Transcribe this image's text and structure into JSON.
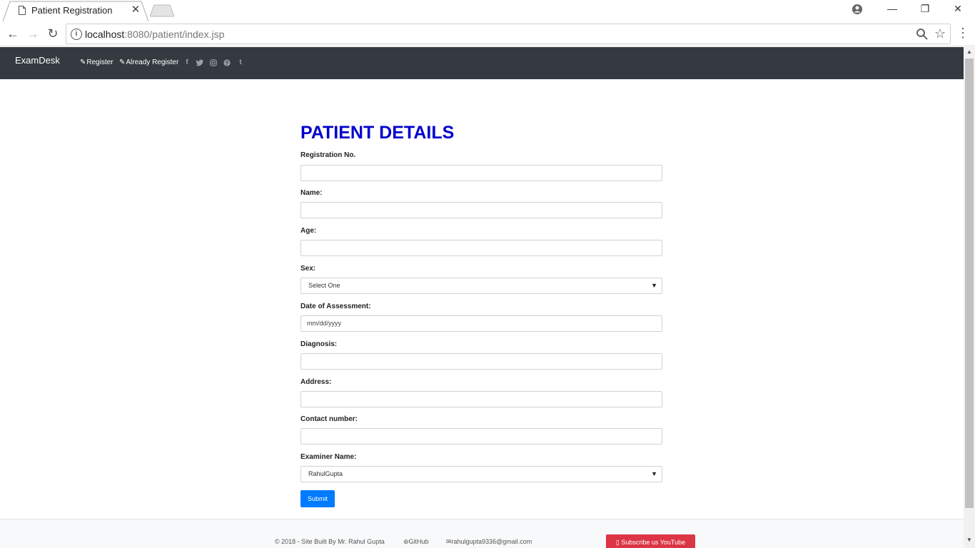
{
  "browser": {
    "tab_title": "Patient Registration",
    "tab_close": "✕",
    "url_host": "localhost",
    "url_rest": ":8080/patient/index.jsp",
    "window_controls": {
      "minimize": "—",
      "maximize": "❐",
      "close": "✕"
    }
  },
  "navbar": {
    "brand": "ExamDesk",
    "links": [
      {
        "label": "Register"
      },
      {
        "label": "Already Register"
      }
    ],
    "social_icons": [
      "facebook-icon",
      "twitter-icon",
      "instagram-icon",
      "pinterest-icon",
      "tumblr-icon"
    ],
    "background": "#343a40"
  },
  "form": {
    "title": "PATIENT DETAILS",
    "title_color": "#0000cc",
    "fields": {
      "registration_no": {
        "label": "Registration No.",
        "value": ""
      },
      "name": {
        "label": "Name:",
        "value": ""
      },
      "age": {
        "label": "Age:",
        "value": ""
      },
      "sex": {
        "label": "Sex:",
        "selected": "Select One"
      },
      "date": {
        "label": "Date of Assessment:",
        "placeholder": "mm/dd/yyyy"
      },
      "diagnosis": {
        "label": "Diagnosis:",
        "value": ""
      },
      "address": {
        "label": "Address:",
        "value": ""
      },
      "contact": {
        "label": "Contact number:",
        "value": ""
      },
      "examiner": {
        "label": "Examiner Name:",
        "selected": "RahulGupta"
      }
    },
    "submit_label": "Submit",
    "submit_color": "#007bff"
  },
  "footer": {
    "copyright": "© 2018 - Site Built By Mr. Rahul Gupta",
    "github": "GitHub",
    "email": "rahulgupta9336@gmail.com",
    "youtube_label": "Subscribe us YouTube",
    "youtube_color": "#dc3545"
  }
}
